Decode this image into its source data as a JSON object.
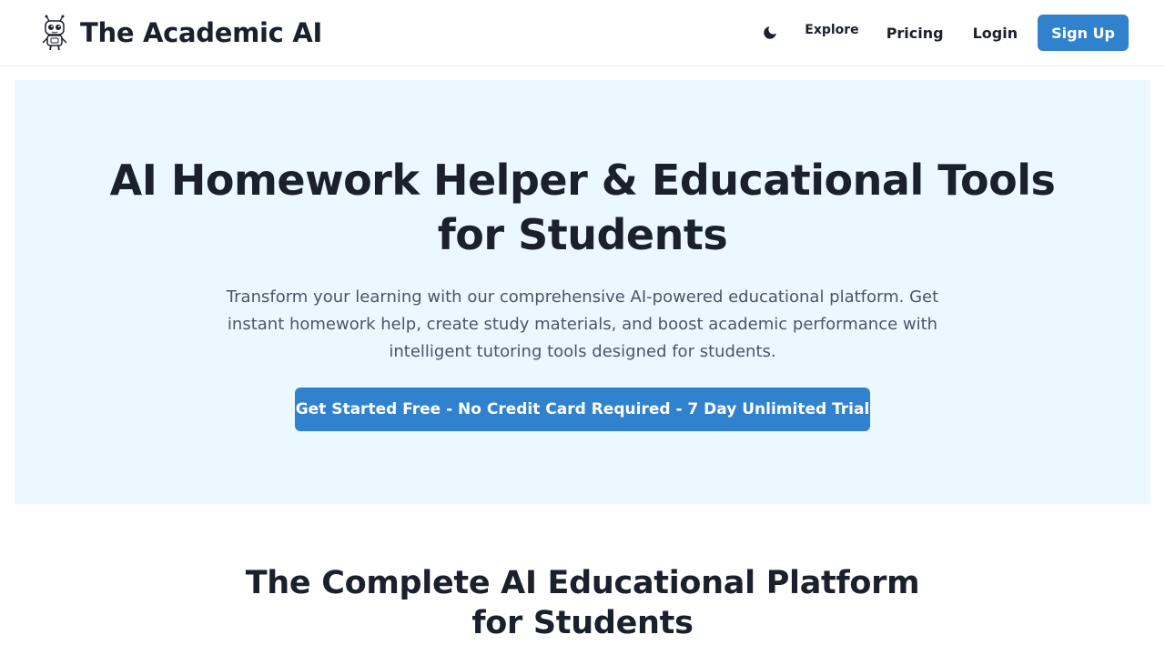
{
  "header": {
    "brand_name": "The Academic AI",
    "logo_icon": "robot-mascot-icon",
    "theme_toggle_icon": "moon-icon",
    "nav": {
      "explore_label": "Explore",
      "pricing_label": "Pricing",
      "login_label": "Login",
      "signup_label": "Sign Up"
    }
  },
  "hero": {
    "title": "AI Homework Helper & Educational Tools for Students",
    "description": "Transform your learning with our comprehensive AI-powered educational platform. Get instant homework help, create study materials, and boost academic performance with intelligent tutoring tools designed for students.",
    "cta_label": "Get Started Free - No Credit Card Required - 7 Day Unlimited Trial"
  },
  "section": {
    "title": "The Complete AI Educational Platform for Students"
  },
  "colors": {
    "primary": "#3182ce",
    "hero_background": "#ebf8ff",
    "heading_text": "#1a202c",
    "body_text": "#4a5568"
  }
}
